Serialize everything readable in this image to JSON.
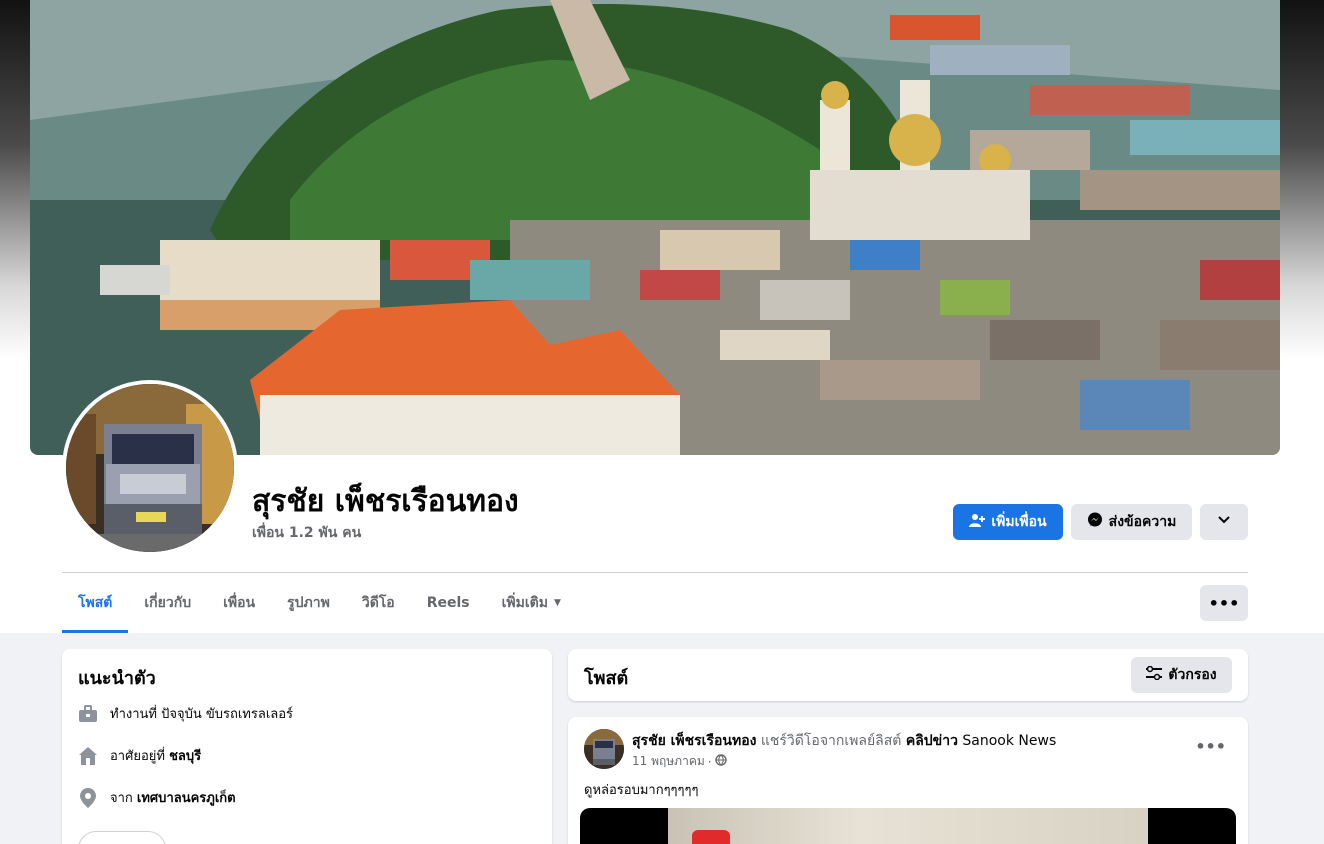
{
  "profile": {
    "name": "สุรชัย เพ็ชรเรือนทอง",
    "friends": "เพื่อน 1.2 พัน คน"
  },
  "actions": {
    "add_friend": "เพิ่มเพื่อน",
    "message": "ส่งข้อความ"
  },
  "tabs": [
    {
      "label": "โพสต์",
      "active": true
    },
    {
      "label": "เกี่ยวกับ"
    },
    {
      "label": "เพื่อน"
    },
    {
      "label": "รูปภาพ"
    },
    {
      "label": "วิดีโอ"
    },
    {
      "label": "Reels"
    },
    {
      "label": "เพิ่มเติม"
    }
  ],
  "intro": {
    "title": "แนะนำตัว",
    "work_prefix": "ทำงานที่ ปัจจุบัน ขับรถเทรลเลอร์",
    "lives_prefix": "อาศัยอยู่ที่ ",
    "lives_value": "ชลบุรี",
    "from_prefix": "จาก ",
    "from_value": "เทศบาลนครภูเก็ต"
  },
  "posts": {
    "title": "โพสต์",
    "filter_label": "ตัวกรอง"
  },
  "post": {
    "author": "สุรชัย เพ็ชรเรือนทอง",
    "action_text": " แชร์วิดีโอจากเพลย์ลิสต์ ",
    "playlist": "คลิปข่าว",
    "page_name": " Sanook News",
    "date": "11 พฤษภาคม",
    "separator": "·",
    "text": "ดูหล่อรอบมากๆๆๆๆๆ"
  },
  "colors": {
    "accent": "#1b74e4",
    "background": "#f0f2f5",
    "secondary_button": "#e4e6eb"
  },
  "icons": {
    "add_friend": "person-plus-icon",
    "message": "messenger-icon",
    "dropdown": "chevron-down-icon",
    "more": "ellipsis-icon",
    "filter": "sliders-icon",
    "work": "briefcase-icon",
    "home": "home-icon",
    "location": "location-pin-icon",
    "privacy": "globe-icon"
  }
}
